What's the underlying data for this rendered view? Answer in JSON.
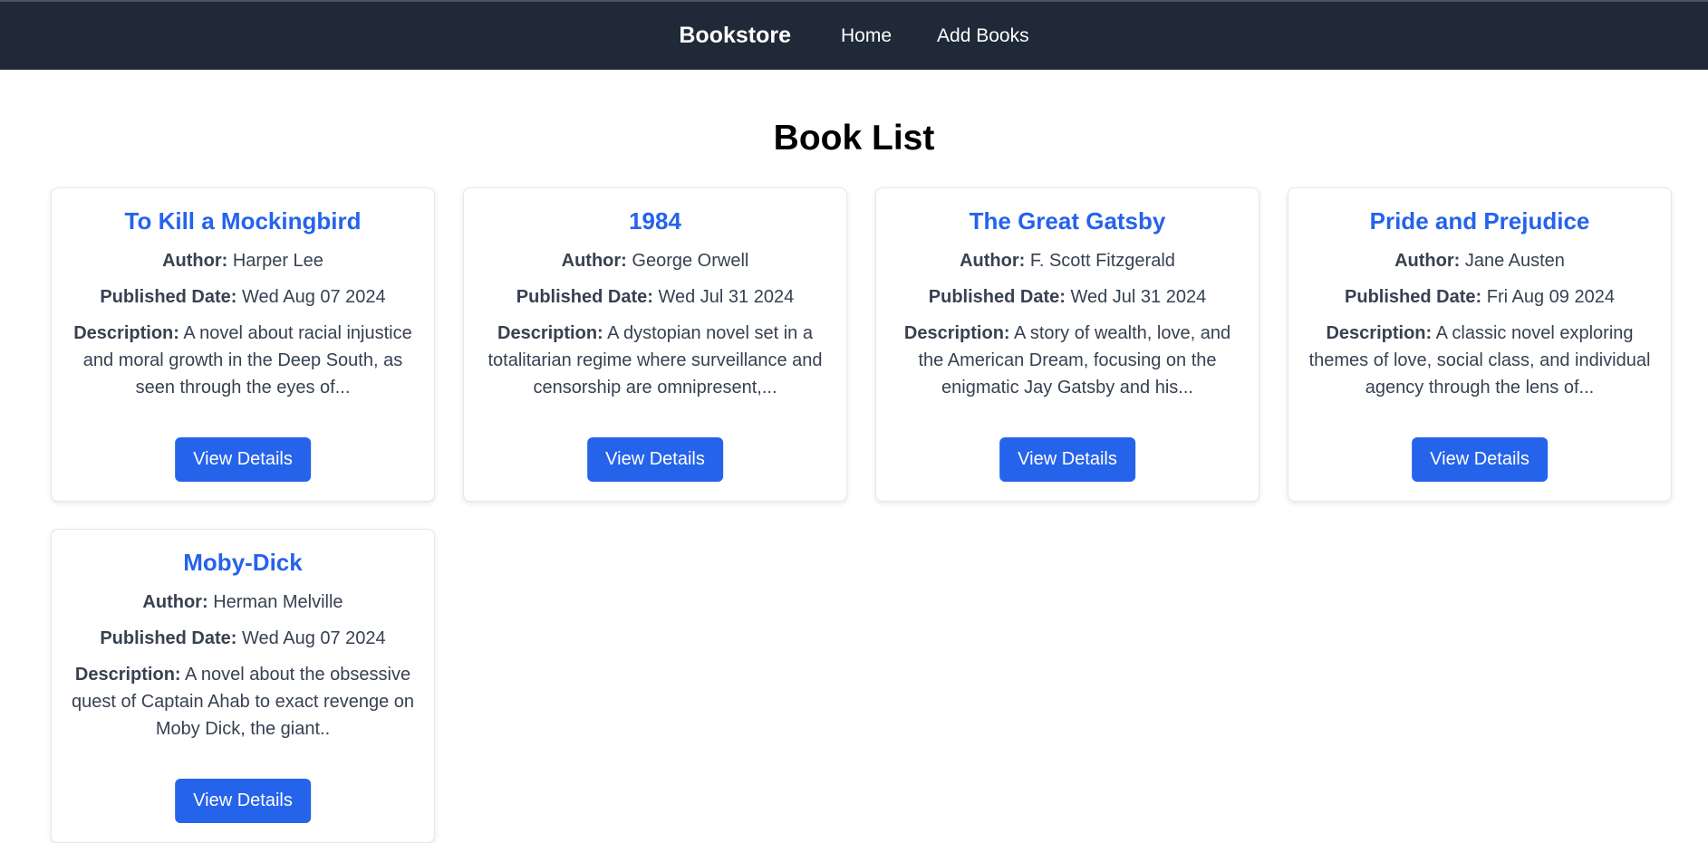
{
  "nav": {
    "brand": "Bookstore",
    "links": [
      "Home",
      "Add Books"
    ]
  },
  "page": {
    "title": "Book List"
  },
  "labels": {
    "author": "Author:",
    "published": "Published Date:",
    "description": "Description:",
    "view_details": "View Details"
  },
  "books": [
    {
      "title": "To Kill a Mockingbird",
      "author": "Harper Lee",
      "published": "Wed Aug 07 2024",
      "description": "A novel about racial injustice and moral growth in the Deep South, as seen through the eyes of..."
    },
    {
      "title": "1984",
      "author": "George Orwell",
      "published": "Wed Jul 31 2024",
      "description": "A dystopian novel set in a totalitarian regime where surveillance and censorship are omnipresent,..."
    },
    {
      "title": "The Great Gatsby",
      "author": "F. Scott Fitzgerald",
      "published": "Wed Jul 31 2024",
      "description": "A story of wealth, love, and the American Dream, focusing on the enigmatic Jay Gatsby and his..."
    },
    {
      "title": "Pride and Prejudice",
      "author": "Jane Austen",
      "published": "Fri Aug 09 2024",
      "description": "A classic novel exploring themes of love, social class, and individual agency through the lens of..."
    },
    {
      "title": "Moby-Dick",
      "author": "Herman Melville",
      "published": "Wed Aug 07 2024",
      "description": "A novel about the obsessive quest of Captain Ahab to exact revenge on Moby Dick, the giant.."
    }
  ],
  "colors": {
    "navbar": "#1f2937",
    "accent": "#2563eb",
    "text": "#374151"
  }
}
